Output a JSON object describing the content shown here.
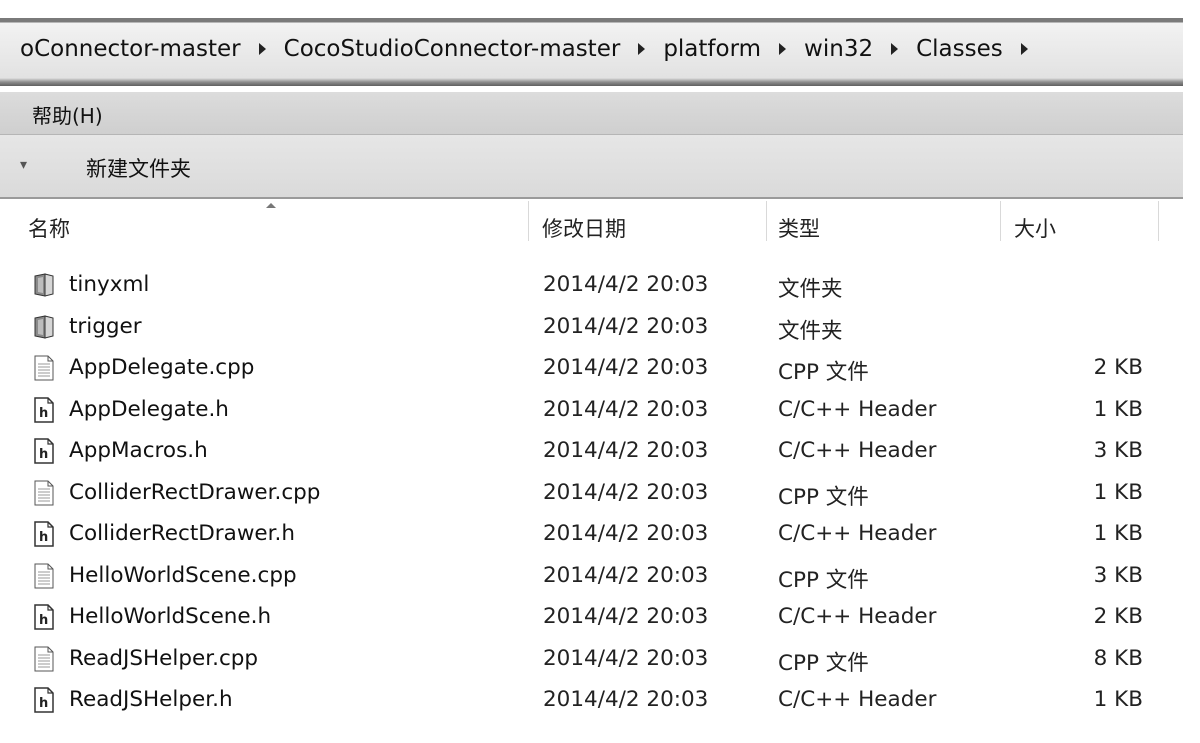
{
  "breadcrumb": [
    "oConnector-master",
    "CocoStudioConnector-master",
    "platform",
    "win32",
    "Classes"
  ],
  "menu": {
    "help": "帮助(H)"
  },
  "toolbar": {
    "dropdown_glyph": "▾",
    "new_folder": "新建文件夹"
  },
  "columns": {
    "name": "名称",
    "date": "修改日期",
    "type": "类型",
    "size": "大小"
  },
  "files": [
    {
      "name": "tinyxml",
      "date": "2014/4/2 20:03",
      "type": "文件夹",
      "size": "",
      "icon": "folder-icon"
    },
    {
      "name": "trigger",
      "date": "2014/4/2 20:03",
      "type": "文件夹",
      "size": "",
      "icon": "folder-icon"
    },
    {
      "name": "AppDelegate.cpp",
      "date": "2014/4/2 20:03",
      "type": "CPP 文件",
      "size": "2 KB",
      "icon": "cpp-file-icon"
    },
    {
      "name": "AppDelegate.h",
      "date": "2014/4/2 20:03",
      "type": "C/C++ Header",
      "size": "1 KB",
      "icon": "header-file-icon"
    },
    {
      "name": "AppMacros.h",
      "date": "2014/4/2 20:03",
      "type": "C/C++ Header",
      "size": "3 KB",
      "icon": "header-file-icon"
    },
    {
      "name": "ColliderRectDrawer.cpp",
      "date": "2014/4/2 20:03",
      "type": "CPP 文件",
      "size": "1 KB",
      "icon": "cpp-file-icon"
    },
    {
      "name": "ColliderRectDrawer.h",
      "date": "2014/4/2 20:03",
      "type": "C/C++ Header",
      "size": "1 KB",
      "icon": "header-file-icon"
    },
    {
      "name": "HelloWorldScene.cpp",
      "date": "2014/4/2 20:03",
      "type": "CPP 文件",
      "size": "3 KB",
      "icon": "cpp-file-icon"
    },
    {
      "name": "HelloWorldScene.h",
      "date": "2014/4/2 20:03",
      "type": "C/C++ Header",
      "size": "2 KB",
      "icon": "header-file-icon"
    },
    {
      "name": "ReadJSHelper.cpp",
      "date": "2014/4/2 20:03",
      "type": "CPP 文件",
      "size": "8 KB",
      "icon": "cpp-file-icon"
    },
    {
      "name": "ReadJSHelper.h",
      "date": "2014/4/2 20:03",
      "type": "C/C++ Header",
      "size": "1 KB",
      "icon": "header-file-icon"
    }
  ]
}
